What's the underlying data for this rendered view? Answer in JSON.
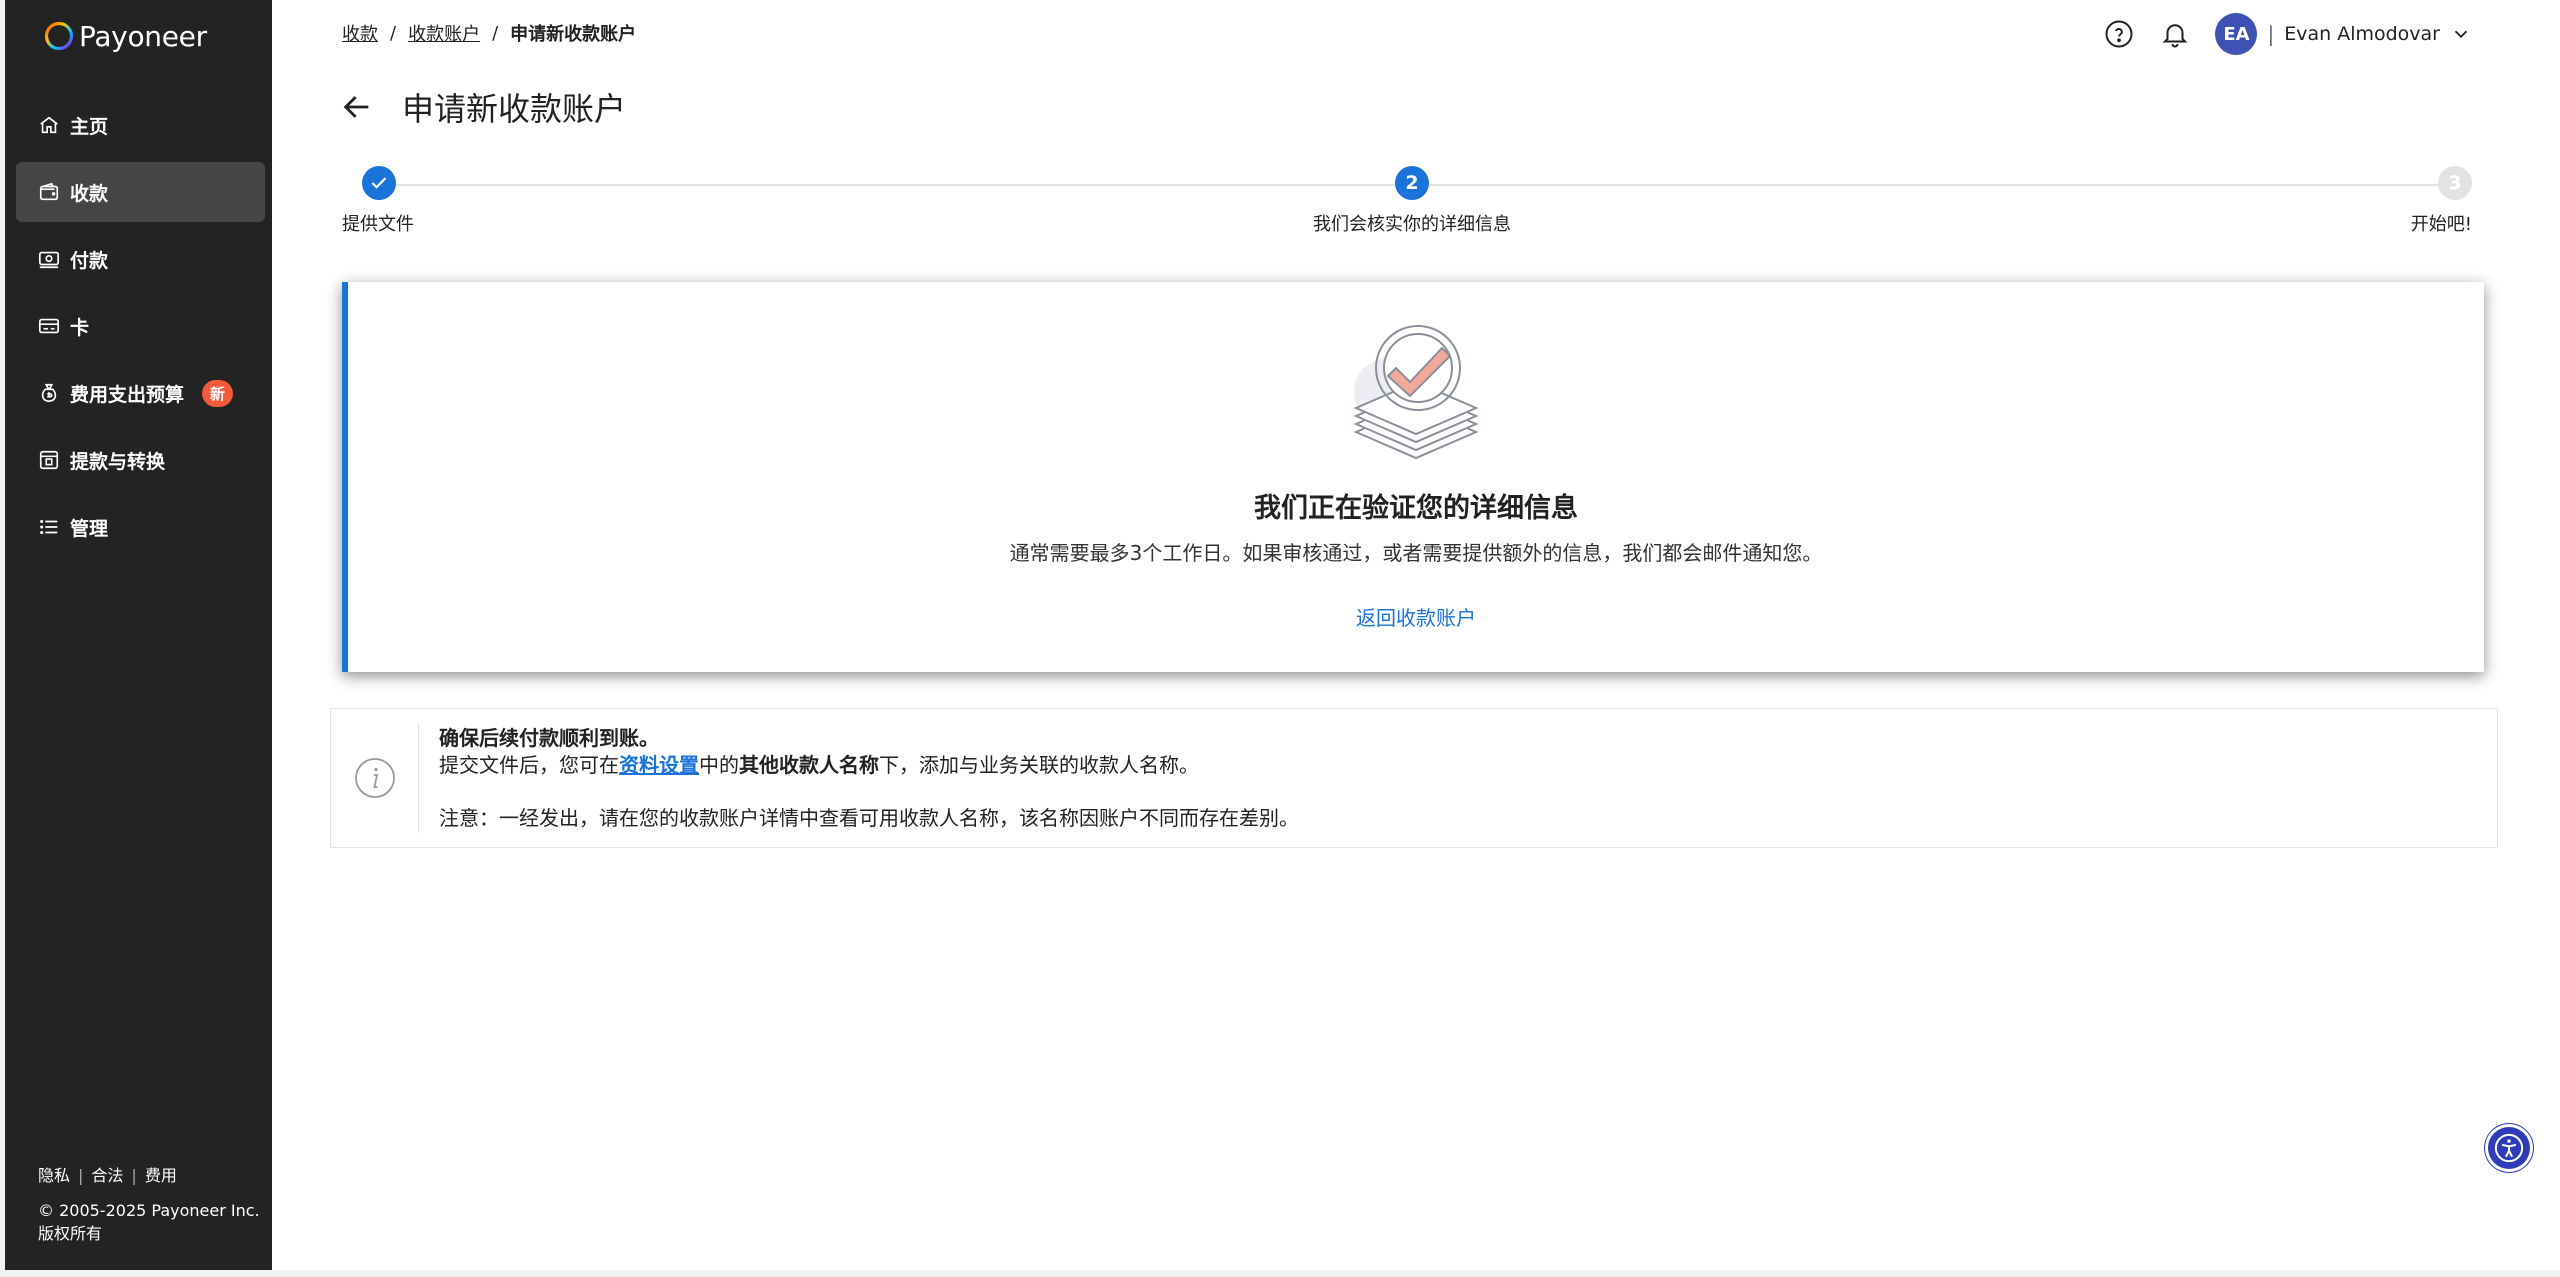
{
  "brand": {
    "name": "Payoneer"
  },
  "sidebar": {
    "items": [
      {
        "label": "主页",
        "icon": "home-icon"
      },
      {
        "label": "收款",
        "icon": "wallet-icon",
        "active": true
      },
      {
        "label": "付款",
        "icon": "cash-icon"
      },
      {
        "label": "卡",
        "icon": "card-icon"
      },
      {
        "label": "费用支出预算",
        "icon": "money-bag-icon",
        "badge": "新"
      },
      {
        "label": "提款与转换",
        "icon": "withdraw-icon"
      },
      {
        "label": "管理",
        "icon": "list-icon"
      }
    ],
    "footer": {
      "links": [
        "隐私",
        "合法",
        "费用"
      ],
      "separator": "|",
      "copyright": "© 2005-2025 Payoneer Inc.",
      "rights": "版权所有"
    }
  },
  "breadcrumb": {
    "items": [
      "收款",
      "收款账户"
    ],
    "current": "申请新收款账户",
    "separator": "/"
  },
  "header": {
    "user_initials": "EA",
    "user_name": "Evan Almodovar",
    "separator": "|"
  },
  "page": {
    "title": "申请新收款账户"
  },
  "stepper": {
    "steps": [
      {
        "label": "提供文件",
        "state": "done"
      },
      {
        "label": "我们会核实你的详细信息",
        "number": "2",
        "state": "current"
      },
      {
        "label": "开始吧!",
        "number": "3",
        "state": "todo"
      }
    ]
  },
  "card": {
    "title": "我们正在验证您的详细信息",
    "description": "通常需要最多3个工作日。如果审核通过，或者需要提供额外的信息，我们都会邮件通知您。",
    "link": "返回收款账户"
  },
  "info": {
    "title": "确保后续付款顺利到账。",
    "line_prefix": "提交文件后，您可在",
    "line_link": "资料设置",
    "line_mid": "中的",
    "line_bold": "其他收款人名称",
    "line_suffix": "下，添加与业务关联的收款人名称。",
    "note": "注意：一经发出，请在您的收款账户详情中查看可用收款人名称，该名称因账户不同而存在差别。"
  },
  "colors": {
    "sidebar_bg": "#232323",
    "accent": "#1a73d9",
    "badge": "#f15a3b",
    "avatar": "#3f51b5"
  }
}
